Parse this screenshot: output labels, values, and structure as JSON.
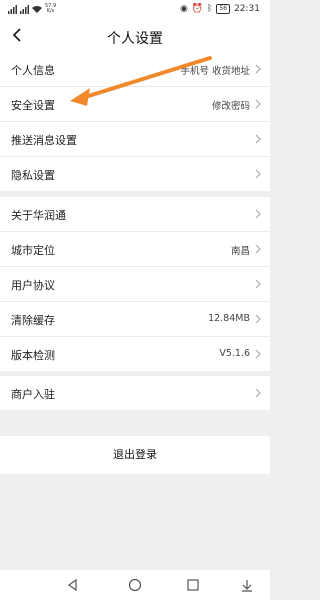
{
  "status_bar": {
    "speed_value": "57.9",
    "speed_unit": "K/s",
    "battery": "56",
    "time": "22:31"
  },
  "header": {
    "title": "个人设置"
  },
  "sections": {
    "group1": [
      {
        "label": "个人信息",
        "value": "手机号 收货地址"
      },
      {
        "label": "安全设置",
        "value": "修改密码"
      },
      {
        "label": "推送消息设置",
        "value": ""
      },
      {
        "label": "隐私设置",
        "value": ""
      }
    ],
    "group2": [
      {
        "label": "关于华润通",
        "value": ""
      },
      {
        "label": "城市定位",
        "value": "南昌"
      },
      {
        "label": "用户协议",
        "value": ""
      },
      {
        "label": "清除缓存",
        "value": "12.84MB"
      },
      {
        "label": "版本检测",
        "value": "V5.1.6"
      }
    ],
    "group3": [
      {
        "label": "商户入驻",
        "value": ""
      }
    ]
  },
  "logout_label": "退出登录",
  "colors": {
    "annotation_arrow": "#f08a2c",
    "background": "#efefef"
  }
}
